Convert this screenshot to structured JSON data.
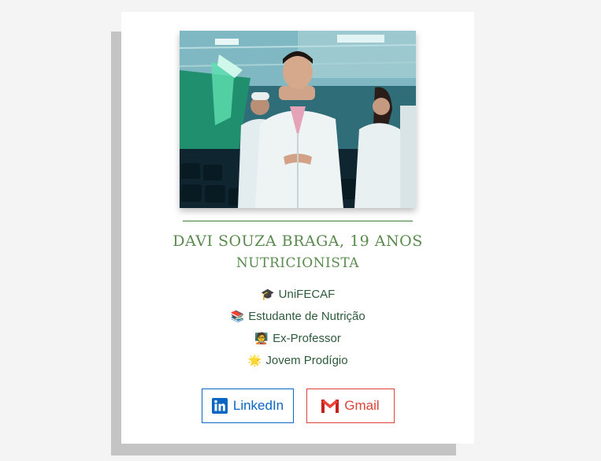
{
  "profile": {
    "photo_alt": "Davi Souza Braga",
    "name": "DAVI SOUZA BRAGA, 19 ANOS",
    "role": "NUTRICIONISTA"
  },
  "facts": [
    {
      "emoji": "🎓",
      "icon": "graduation-cap-icon",
      "text": "UniFECAF"
    },
    {
      "emoji": "📚",
      "icon": "books-icon",
      "text": "Estudante de Nutrição"
    },
    {
      "emoji": "🧑‍🏫",
      "icon": "teacher-icon",
      "text": "Ex-Professor"
    },
    {
      "emoji": "🌟",
      "icon": "sun-icon",
      "text": "Jovem Prodígio"
    }
  ],
  "buttons": {
    "linkedin": {
      "label": "LinkedIn",
      "icon": "linkedin-icon",
      "color": "#0a66c2"
    },
    "gmail": {
      "label": "Gmail",
      "icon": "gmail-icon",
      "color": "#db4437"
    }
  },
  "colors": {
    "accent_green": "#5a8a4e",
    "text_green": "#2d5a3a",
    "card": "#ffffff",
    "shadow": "#c4c4c4",
    "background": "#f4f4f4"
  }
}
